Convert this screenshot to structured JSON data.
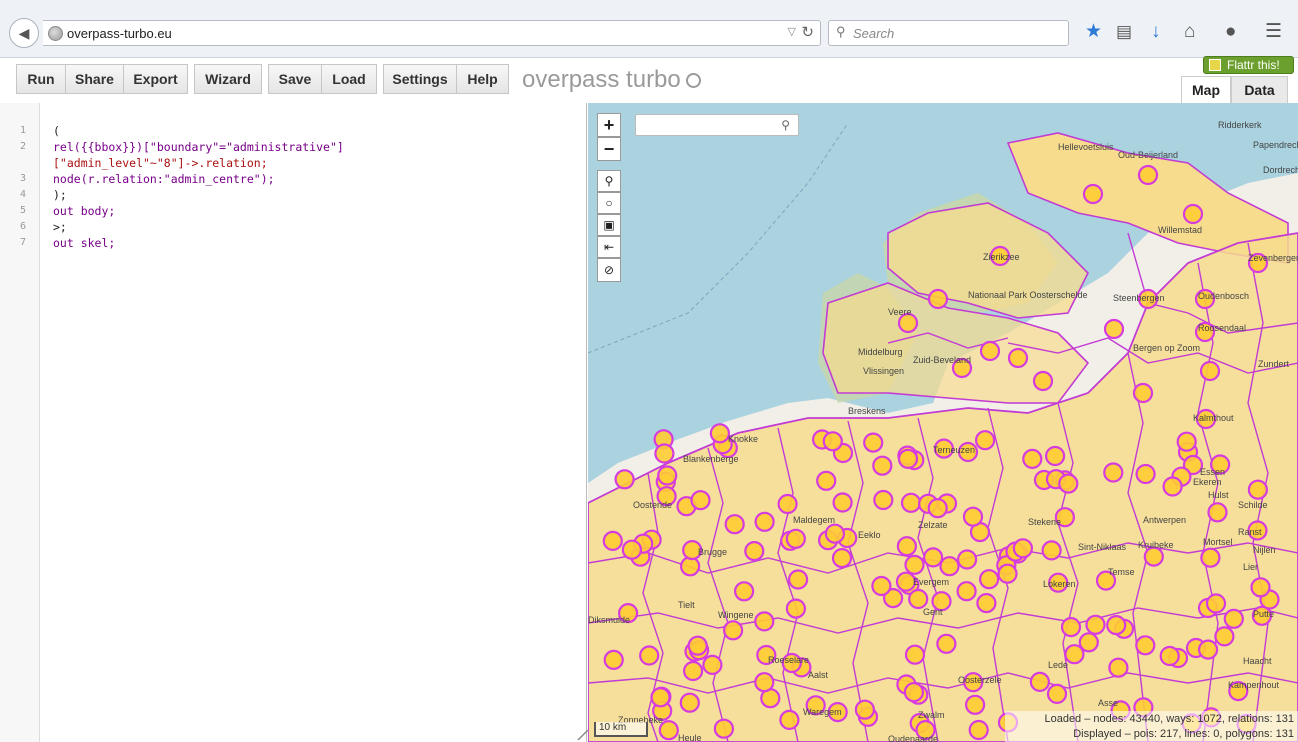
{
  "browser": {
    "url": "overpass-turbo.eu",
    "search_placeholder": "Search"
  },
  "toolbar": {
    "run": "Run",
    "share": "Share",
    "export": "Export",
    "wizard": "Wizard",
    "save": "Save",
    "load": "Load",
    "settings": "Settings",
    "help": "Help",
    "brand": "overpass turbo",
    "flattr": "Flattr this!"
  },
  "tabs": {
    "map": "Map",
    "data": "Data"
  },
  "editor": {
    "lines": [
      {
        "num": "1",
        "text": "("
      },
      {
        "num": "2",
        "text": "rel({{bbox}})[\"boundary\"=\"administrative\"]"
      },
      {
        "num": "",
        "text": "[\"admin_level\"~\"8\"]->.relation;"
      },
      {
        "num": "3",
        "text": "node(r.relation:\"admin_centre\");"
      },
      {
        "num": "4",
        "text": ");"
      },
      {
        "num": "5",
        "text": "out body;"
      },
      {
        "num": "6",
        "text": ">;"
      },
      {
        "num": "7",
        "text": "out skel;"
      }
    ]
  },
  "map": {
    "stats_loaded": "Loaded – nodes: 43440, ways: 1072, relations: 131",
    "stats_displayed": "Displayed – pois: 217, lines: 0, polygons: 131",
    "scale": "10 km",
    "labels": [
      "Hellevoetsluis",
      "Oud-Beijerland",
      "Ridderkerk",
      "Papendrecht",
      "Dordrecht",
      "Willemstad",
      "Zevenbergen",
      "Zierikzee",
      "Nationaal Park Oosterschelde",
      "Steenbergen",
      "Oudenbosch",
      "Veere",
      "Roosendaal",
      "Middelburg",
      "Vlissingen",
      "Zuid-Beveland",
      "Bergen op Zoom",
      "Zundert",
      "Breskens",
      "Kalmthout",
      "Knokke",
      "Blankenberge",
      "Terneuzen",
      "Hulst",
      "Essen",
      "Ekeren",
      "Schilde",
      "Brugge",
      "Maldegem",
      "Eeklo",
      "Zelzate",
      "Stekene",
      "Antwerpen",
      "Ranst",
      "Nijlen",
      "Oostende",
      "Sint-Niklaas",
      "Kruibeke",
      "Mortsel",
      "Lier",
      "Evergem",
      "Lokeren",
      "Temse",
      "Gent",
      "Diksmuide",
      "Tielt",
      "Putte",
      "Lede",
      "Haacht",
      "Kampenhout",
      "Roeselare",
      "Waregem",
      "Oosterzele",
      "Aalst",
      "Asse",
      "Zwalm",
      "Zonnebeke",
      "Heule",
      "Oudenaarde",
      "Wingene"
    ]
  }
}
